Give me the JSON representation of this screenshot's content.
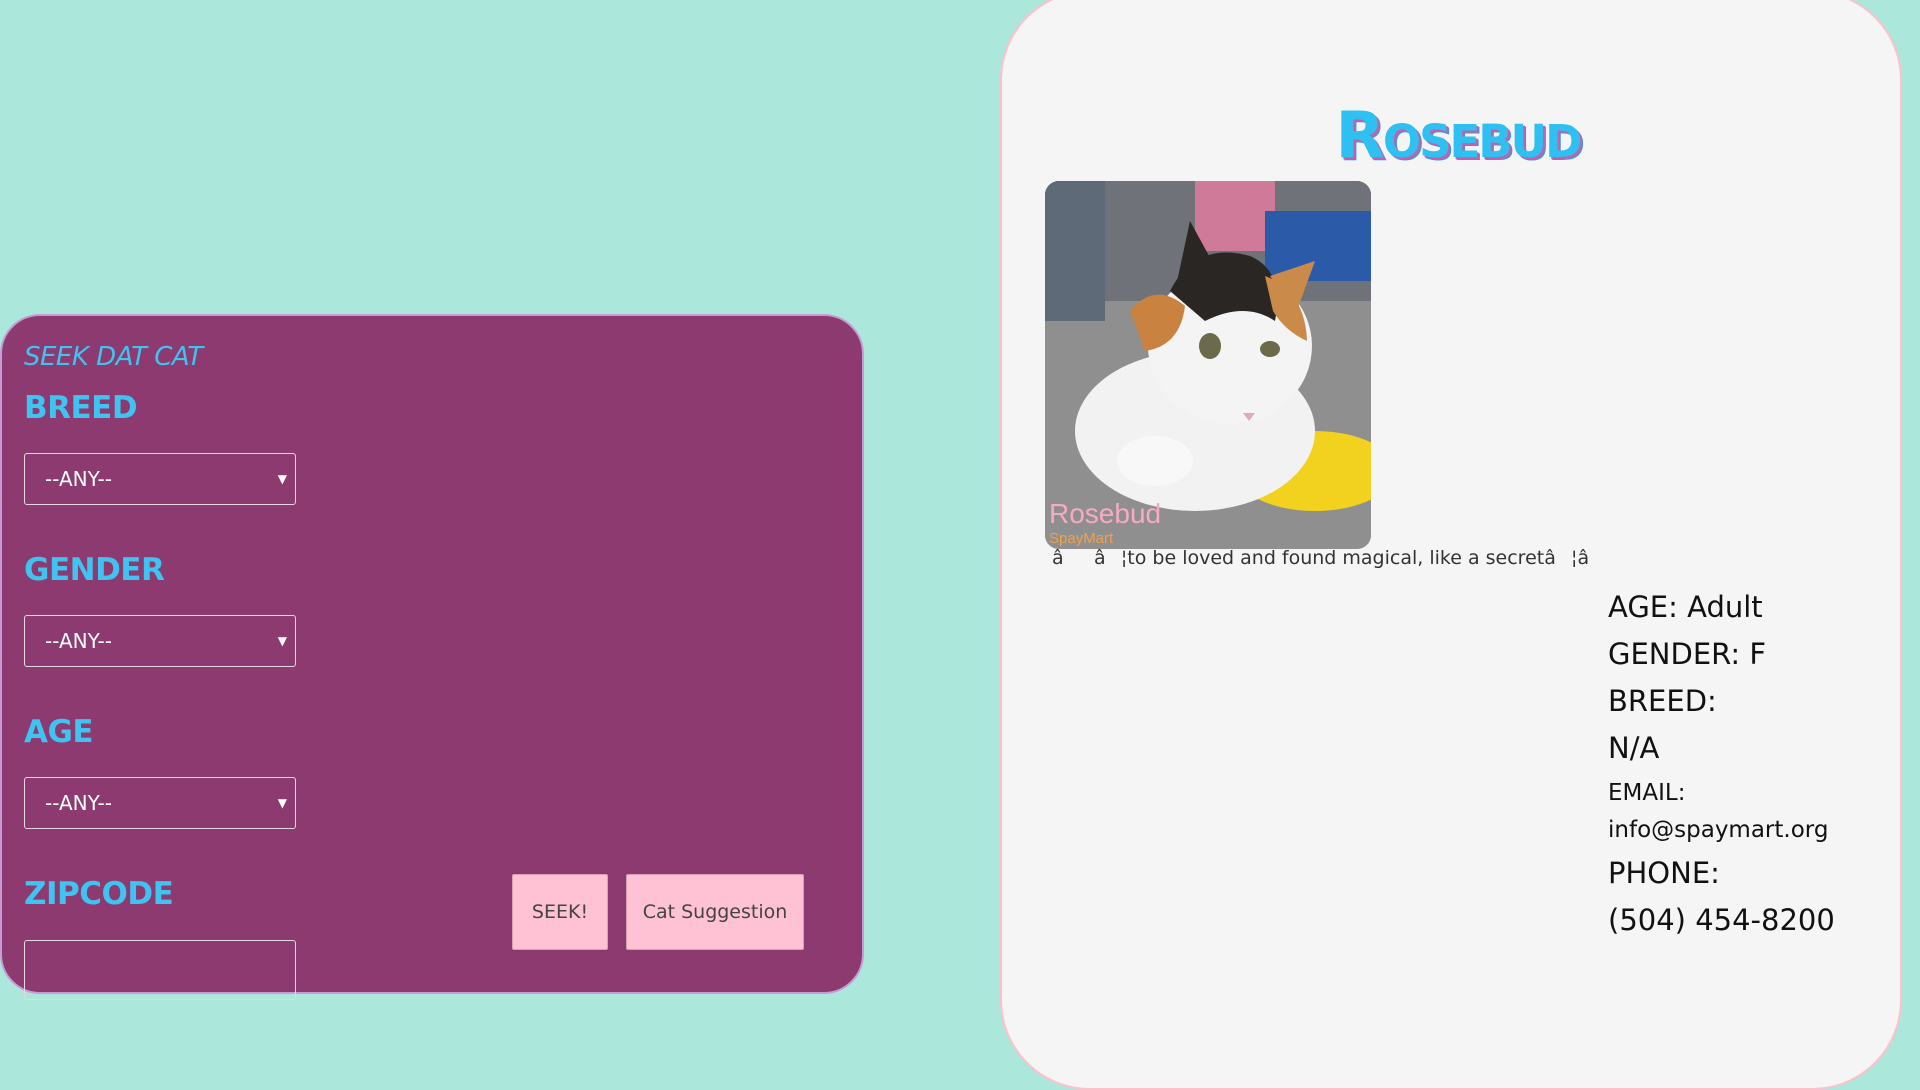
{
  "search": {
    "title": "SEEK DAT CAT",
    "breed": {
      "label": "BREED",
      "selected": "--ANY--"
    },
    "gender": {
      "label": "GENDER",
      "selected": "--ANY--"
    },
    "age": {
      "label": "AGE",
      "selected": "--ANY--"
    },
    "zipcode": {
      "label": "ZIPCODE"
    },
    "seek_button": "SEEK!",
    "suggestion_button": "Cat Suggestion"
  },
  "cat": {
    "name": "Rosebud",
    "photo_watermark": "Rosebud",
    "photo_watermark_sub": "SpayMart",
    "description": "ââ¦to be loved and found magical, like a secretâ¦â",
    "age_line": "AGE: Adult",
    "gender_line": "GENDER: F",
    "breed_label": "BREED:",
    "breed_value": "N/A",
    "email_label": "EMAIL:",
    "email_value": "info@spaymart.org",
    "phone_label": "PHONE:",
    "phone_value": "(504) 454-8200"
  },
  "colors": {
    "background": "#abe7db",
    "panel": "#8c3a70",
    "accent": "#3fc3f0",
    "card": "#f5f5f5",
    "button": "#ffc2d4"
  }
}
